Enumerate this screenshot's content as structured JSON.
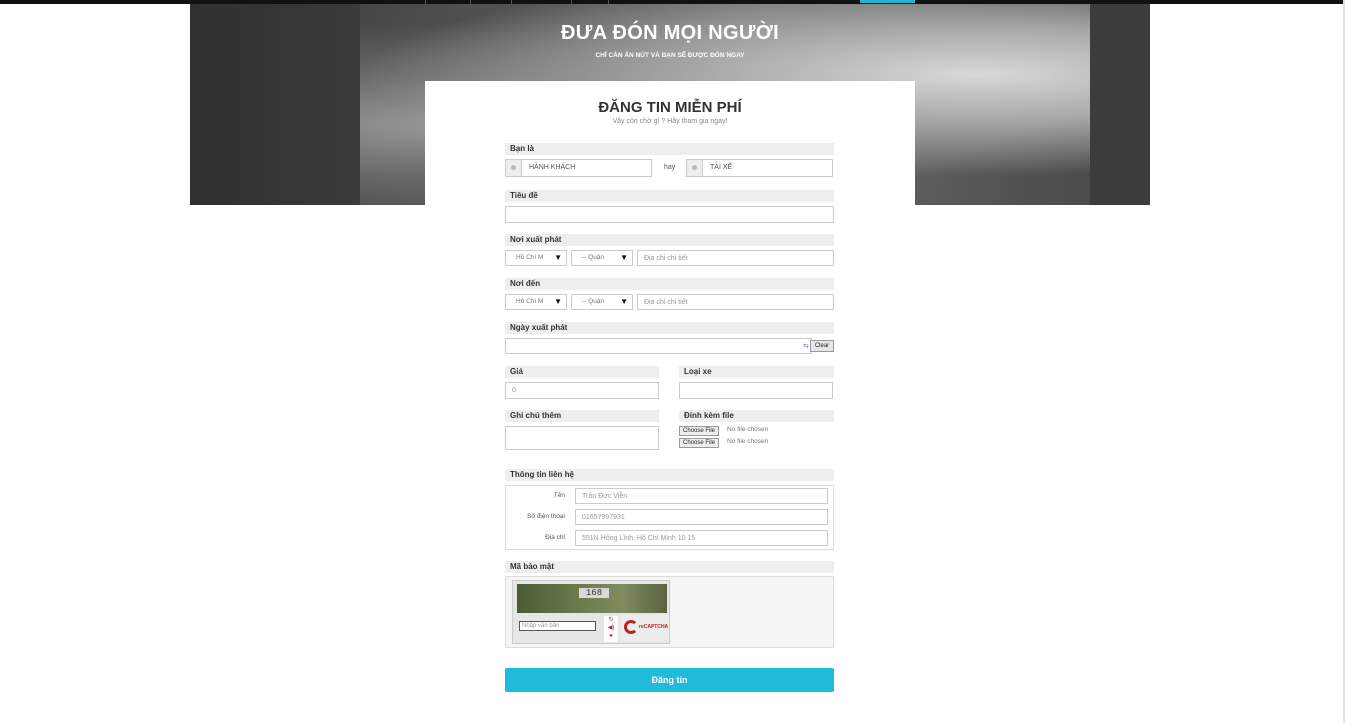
{
  "colors": {
    "accent": "#1fbbd9",
    "label_bg": "#eeeeee"
  },
  "hero": {
    "title": "ĐƯA ĐÓN MỌI NGƯỜI",
    "subtitle": "CHỈ CẦN ẤN NÚT VÀ BẠN SẼ ĐƯỢC ĐÓN NGAY"
  },
  "form": {
    "title": "ĐĂNG TIN MIỄN PHÍ",
    "subtitle": "Vậy còn chờ gì ? Hãy tham gia ngay!",
    "role": {
      "label": "Bạn là",
      "option_passenger": "HÀNH KHÁCH",
      "or_text": "hay",
      "option_driver": "TÀI XẾ"
    },
    "title_field": {
      "label": "Tiêu đề",
      "value": ""
    },
    "origin": {
      "label": "Nơi xuất phát",
      "city": "Hồ Chí M",
      "district": "-- Quận",
      "address_placeholder": "Địa chỉ chi tiết"
    },
    "destination": {
      "label": "Nơi đến",
      "city": "Hồ Chí M",
      "district": "-- Quận",
      "address_placeholder": "Địa chỉ chi tiết"
    },
    "date": {
      "label": "Ngày xuất phát",
      "value": "",
      "clear_label": "Clear"
    },
    "price": {
      "label": "Giá",
      "value": "0"
    },
    "vehicle": {
      "label": "Loại xe",
      "value": ""
    },
    "note": {
      "label": "Ghi chú thêm",
      "value": ""
    },
    "attach": {
      "label": "Đính kèm file",
      "button": "Choose File",
      "status": "No file chosen"
    },
    "contact": {
      "label": "Thông tin liên hệ",
      "name_label": "Tên",
      "name_value": "Trần Đức Viễn",
      "phone_label": "Số điện thoại",
      "phone_value": "01657997931",
      "address_label": "Địa chỉ",
      "address_value": "551N Hồng Lĩnh, Hồ Chí Minh 10 15"
    },
    "captcha": {
      "label": "Mã bảo mật",
      "image_text": "168",
      "input_placeholder": "Nhập văn bản",
      "brand": "reCAPTCHA"
    },
    "submit_label": "Đăng tin"
  }
}
